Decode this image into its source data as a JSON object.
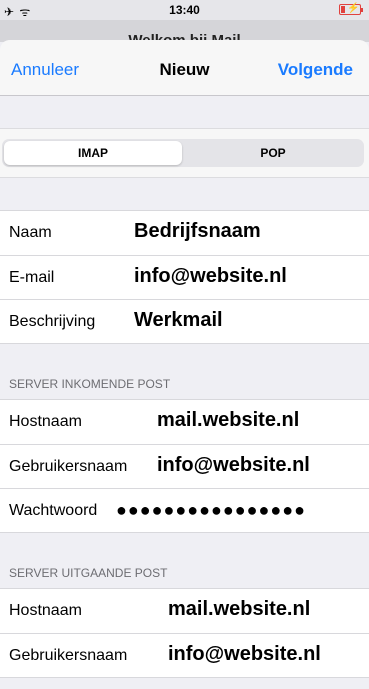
{
  "status_bar": {
    "left_icons": "✈ ᯤ",
    "time": "13:40"
  },
  "background_title": "Welkom bij Mail",
  "nav": {
    "cancel_label": "Annuleer",
    "title": "Nieuw",
    "next_label": "Volgende"
  },
  "segmented": {
    "options": [
      "IMAP",
      "POP"
    ],
    "selected": "IMAP"
  },
  "account": {
    "rows": [
      {
        "label": "Naam",
        "value": "Bedrijfsnaam"
      },
      {
        "label": "E-mail",
        "value": "info@website.nl"
      },
      {
        "label": "Beschrijving",
        "value": "Werkmail"
      }
    ]
  },
  "incoming": {
    "header": "SERVER INKOMENDE POST",
    "rows": [
      {
        "label": "Hostnaam",
        "value": "mail.website.nl"
      },
      {
        "label": "Gebruikersnaam",
        "value": "info@website.nl"
      },
      {
        "label": "Wachtwoord",
        "value": "●●●●●●●●●●●●●●●●"
      }
    ]
  },
  "outgoing": {
    "header": "SERVER UITGAANDE POST",
    "rows": [
      {
        "label": "Hostnaam",
        "value": "mail.website.nl"
      },
      {
        "label": "Gebruikersnaam",
        "value": "info@website.nl"
      }
    ]
  },
  "colors": {
    "accent": "#1a7bff",
    "battery_low": "#e0413e"
  }
}
